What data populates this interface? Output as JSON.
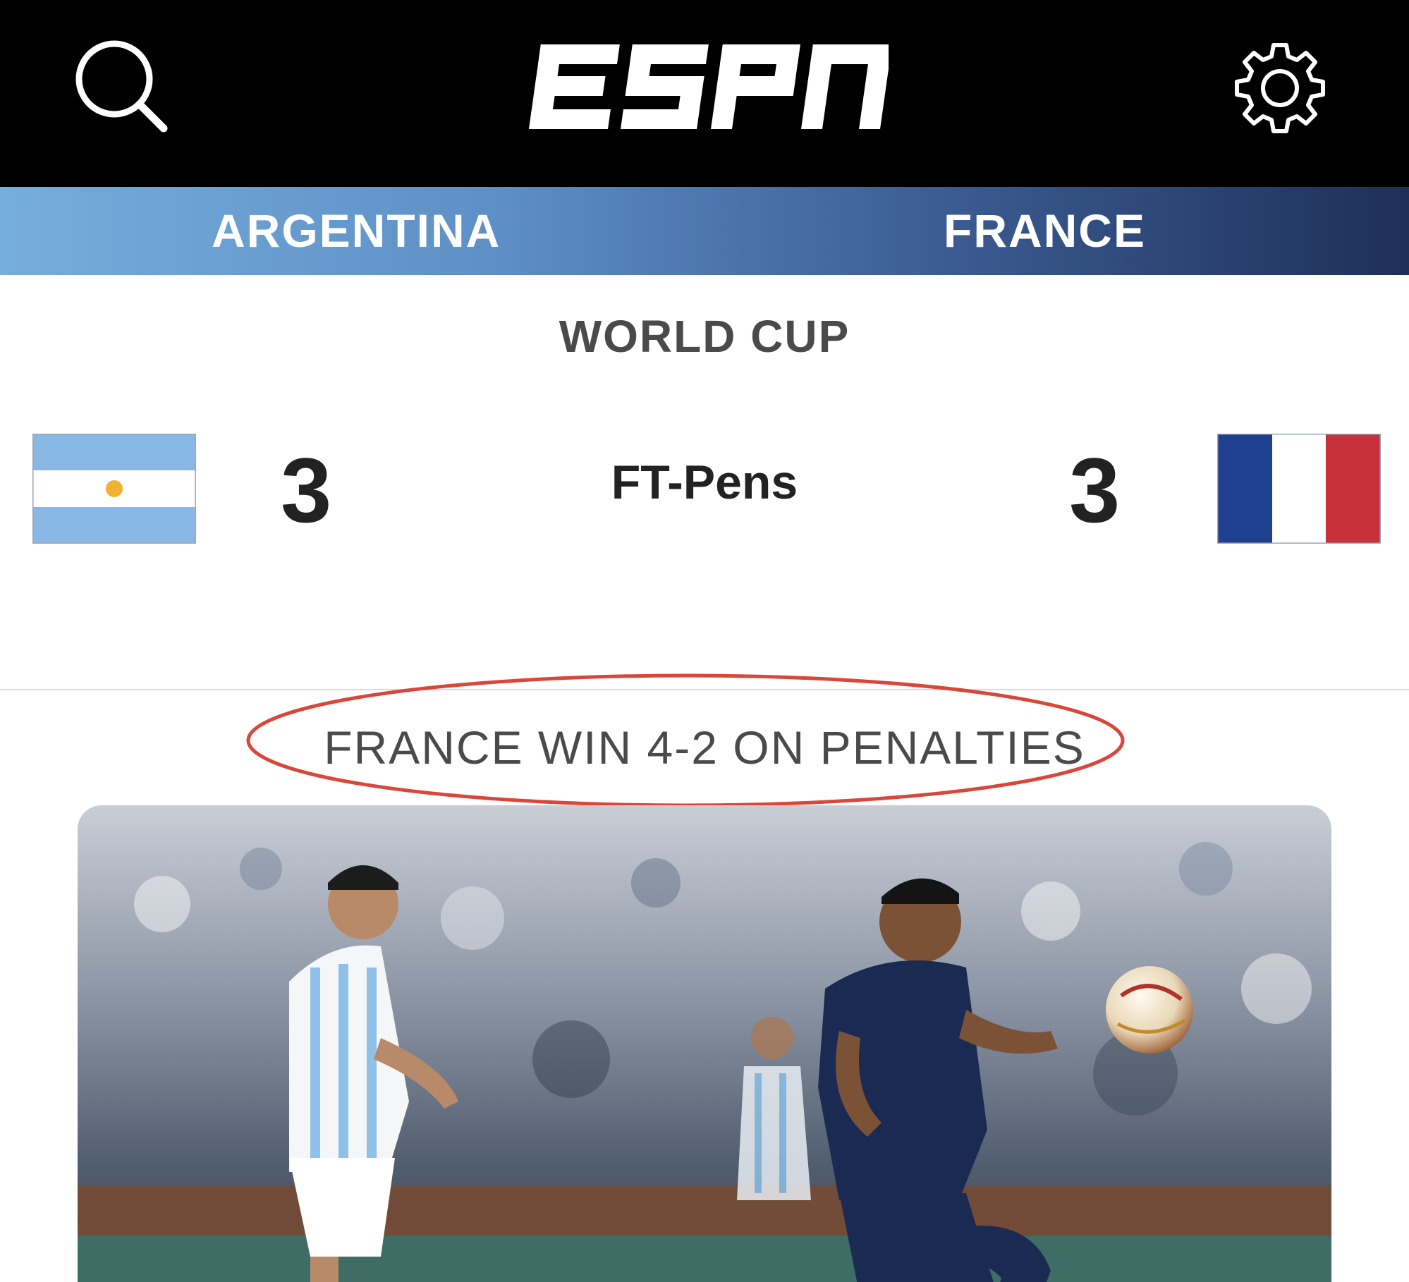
{
  "header": {
    "logo_text": "ESPN",
    "search_icon": "search-icon",
    "settings_icon": "gear-icon"
  },
  "teams": {
    "home": "ARGENTINA",
    "away": "FRANCE"
  },
  "competition": "WORLD CUP",
  "score": {
    "home": "3",
    "away": "3",
    "status": "FT-Pens"
  },
  "headline": "FRANCE WIN 4-2 ON PENALTIES",
  "colors": {
    "header_bg": "#000000",
    "annotation": "#d9473b",
    "argentina_blue": "#74acdf",
    "france_blue": "#1f3f8f",
    "france_red": "#c8303a"
  }
}
